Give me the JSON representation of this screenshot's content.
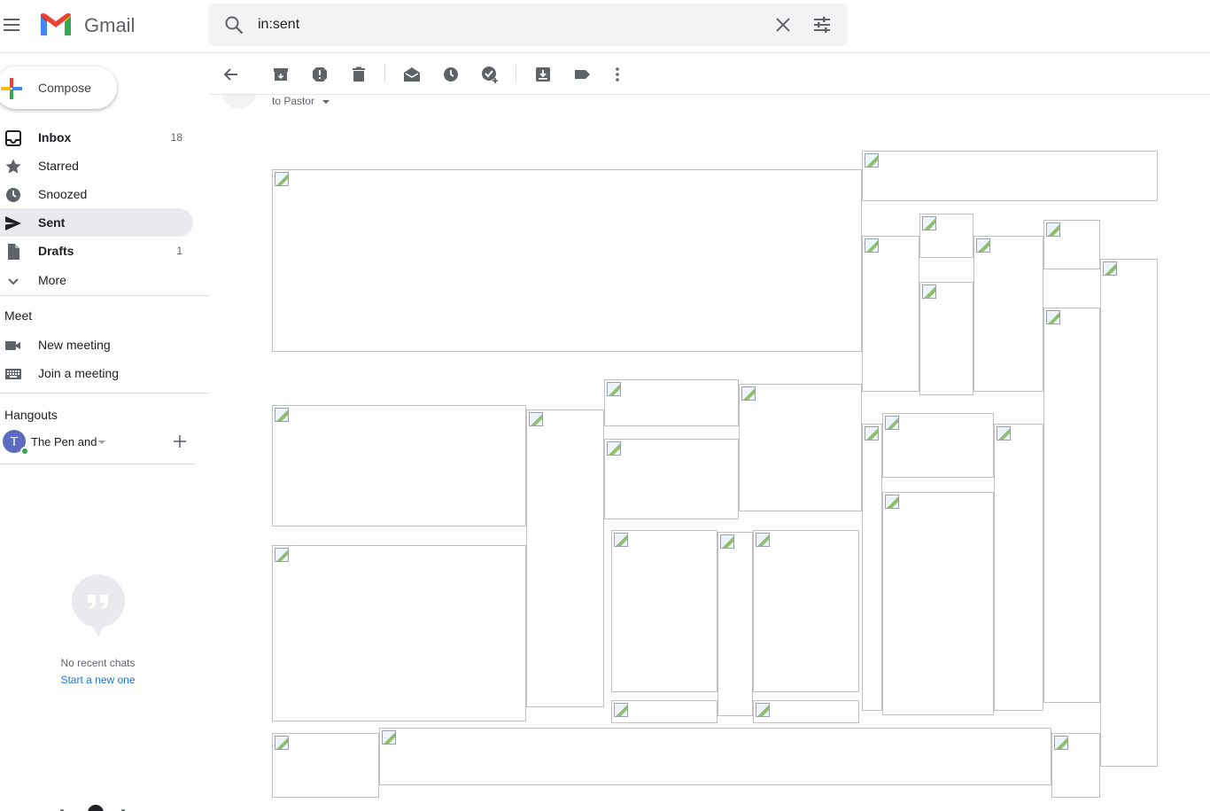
{
  "header": {
    "app_name": "Gmail",
    "search_value": "in:sent"
  },
  "compose": {
    "label": "Compose"
  },
  "nav": [
    {
      "label": "Inbox",
      "count": "18",
      "bold": true
    },
    {
      "label": "Starred",
      "count": "",
      "bold": false
    },
    {
      "label": "Snoozed",
      "count": "",
      "bold": false
    },
    {
      "label": "Sent",
      "count": "",
      "bold": true,
      "active": true
    },
    {
      "label": "Drafts",
      "count": "1",
      "bold": true
    },
    {
      "label": "More",
      "count": "",
      "bold": false
    }
  ],
  "meet": {
    "title": "Meet",
    "new_meeting": "New meeting",
    "join_meeting": "Join a meeting"
  },
  "hangouts": {
    "title": "Hangouts",
    "avatar_letter": "T",
    "user_name": "The Pen and",
    "no_chats": "No recent chats",
    "start_new": "Start a new one"
  },
  "message": {
    "to_line": "to Pastor"
  },
  "colors": {
    "active_nav_bg": "#e8eaed",
    "link": "#1a73e8",
    "avatar": "#5c6bc0",
    "online": "#34a853"
  }
}
